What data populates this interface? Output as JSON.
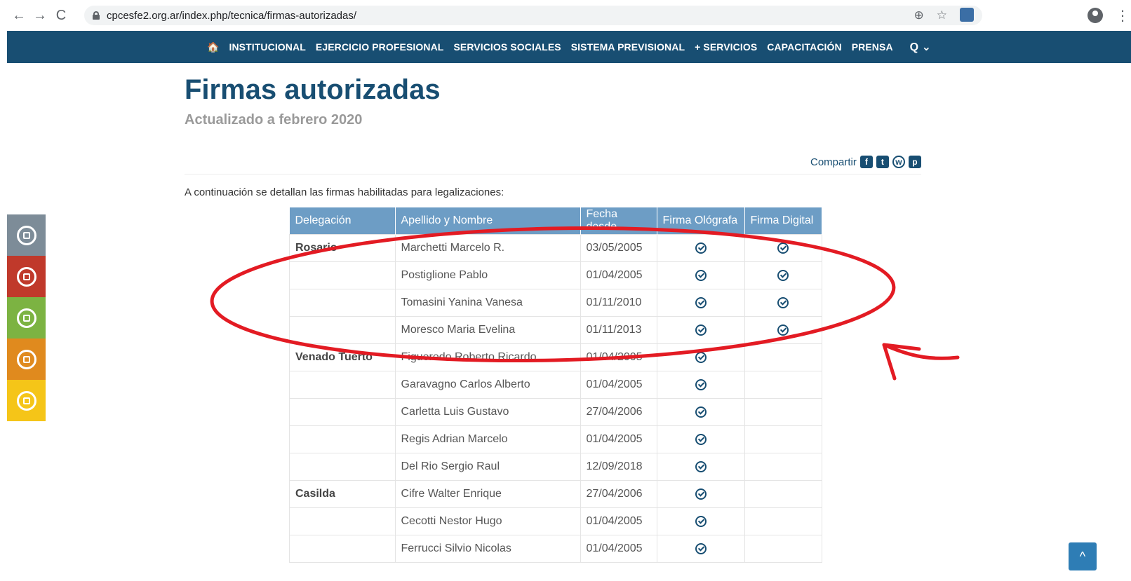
{
  "browser": {
    "url": "cpcesfe2.org.ar/index.php/tecnica/firmas-autorizadas/",
    "back_glyph": "←",
    "forward_glyph": "→",
    "reload_glyph": "C",
    "zoom_glyph": "⊕",
    "star_glyph": "☆",
    "menu_glyph": "⋮"
  },
  "nav": {
    "home_glyph": "🏠",
    "items": [
      "INSTITUCIONAL",
      "EJERCICIO PROFESIONAL",
      "SERVICIOS SOCIALES",
      "SISTEMA PREVISIONAL",
      "+ SERVICIOS",
      "CAPACITACIÓN",
      "PRENSA"
    ],
    "search_glyph": "Q ⌄"
  },
  "side_colors": [
    "#7d8c98",
    "#c0392b",
    "#7cb342",
    "#e08a1e",
    "#f5c518"
  ],
  "page": {
    "title": "Firmas autorizadas",
    "subtitle": "Actualizado a febrero 2020",
    "share_label": "Compartir",
    "share_icons": [
      "f",
      "t",
      "w",
      "p"
    ],
    "intro": "A continuación se detallan las firmas habilitadas para legalizaciones:"
  },
  "table": {
    "headers": [
      "Delegación",
      "Apellido y Nombre",
      "Fecha desde",
      "Firma Ológrafa",
      "Firma Digital"
    ],
    "rows": [
      {
        "delegacion": "Rosario",
        "nombre": "Marchetti Marcelo R.",
        "fecha": "03/05/2005",
        "ologrofa": true,
        "digital": true
      },
      {
        "delegacion": "",
        "nombre": "Postiglione Pablo",
        "fecha": "01/04/2005",
        "ologrofa": true,
        "digital": true
      },
      {
        "delegacion": "",
        "nombre": "Tomasini Yanina Vanesa",
        "fecha": "01/11/2010",
        "ologrofa": true,
        "digital": true
      },
      {
        "delegacion": "",
        "nombre": "Moresco Maria Evelina",
        "fecha": "01/11/2013",
        "ologrofa": true,
        "digital": true
      },
      {
        "delegacion": "Venado Tuerto",
        "nombre": "Figueredo Roberto Ricardo",
        "fecha": "01/04/2005",
        "ologrofa": true,
        "digital": false
      },
      {
        "delegacion": "",
        "nombre": "Garavagno Carlos Alberto",
        "fecha": "01/04/2005",
        "ologrofa": true,
        "digital": false
      },
      {
        "delegacion": "",
        "nombre": "Carletta Luis Gustavo",
        "fecha": "27/04/2006",
        "ologrofa": true,
        "digital": false
      },
      {
        "delegacion": "",
        "nombre": "Regis Adrian Marcelo",
        "fecha": "01/04/2005",
        "ologrofa": true,
        "digital": false
      },
      {
        "delegacion": "",
        "nombre": "Del Rio Sergio Raul",
        "fecha": "12/09/2018",
        "ologrofa": true,
        "digital": false
      },
      {
        "delegacion": "Casilda",
        "nombre": "Cifre Walter Enrique",
        "fecha": "27/04/2006",
        "ologrofa": true,
        "digital": false
      },
      {
        "delegacion": "",
        "nombre": "Cecotti Nestor Hugo",
        "fecha": "01/04/2005",
        "ologrofa": true,
        "digital": false
      },
      {
        "delegacion": "",
        "nombre": "Ferrucci Silvio Nicolas",
        "fecha": "01/04/2005",
        "ologrofa": true,
        "digital": false
      }
    ]
  },
  "annotation_color": "#e31b23",
  "scroll_top_glyph": "^"
}
